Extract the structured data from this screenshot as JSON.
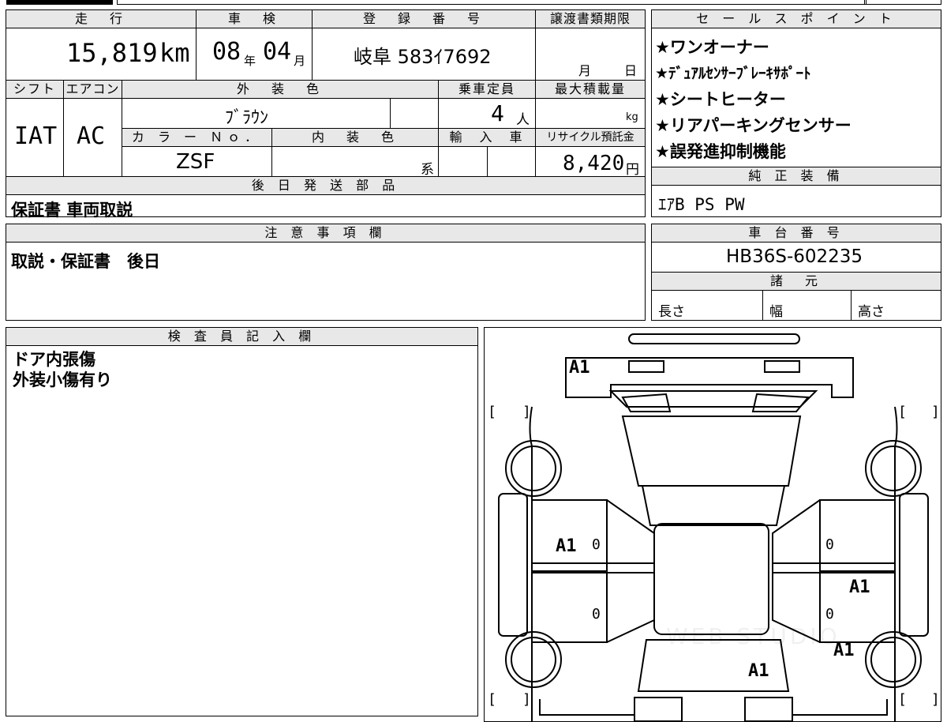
{
  "headers": {
    "mileage": "走　行",
    "inspection": "車　検",
    "registration": "登　録　番　号",
    "transfer_deadline": "譲渡書類期限",
    "sales_points": "セ ー ル ス ポ イ ン ト",
    "shift": "シフト",
    "aircon": "エアコン",
    "exterior_color": "外　装　色",
    "capacity": "乗車定員",
    "max_load": "最大積載量",
    "color_no": "カ ラ ー Ｎｏ．",
    "interior_color": "内　装　色",
    "import": "輸　入　車",
    "recycle_fee": "リサイクル預託金",
    "later_parts": "後 日 発 送 部 品",
    "genuine_equipment": "純 正 装 備",
    "notes": "注 意 事 項 欄",
    "chassis_no": "車 台 番 号",
    "specs": "諸　元",
    "inspector": "検 査 員 記 入 欄"
  },
  "vehicle": {
    "mileage_value": "15,819",
    "mileage_unit": "km",
    "inspection_year": "08",
    "inspection_year_unit": "年",
    "inspection_month": "04",
    "inspection_month_unit": "月",
    "registration_no": "岐阜 583ｲ7692",
    "deadline_month_unit": "月",
    "deadline_day_unit": "日",
    "shift": "IAT",
    "aircon": "AC",
    "exterior_color": "ﾌﾞﾗｳﾝ",
    "capacity_value": "4",
    "capacity_unit": "人",
    "max_load_unit": "kg",
    "color_no": "ZSF",
    "interior_unit": "系",
    "recycle_value": "8,420",
    "recycle_unit": "円"
  },
  "sales_points": [
    "★ワンオーナー",
    "★ﾃﾞｭｱﾙｾﾝｻｰﾌﾞﾚｰｷｻﾎﾟｰﾄ",
    "★シートヒーター",
    "★リアパーキングセンサー",
    "★誤発進抑制機能"
  ],
  "later_parts_value": "保証書 車両取説",
  "genuine_equipment_value": "ｴｱB PS PW",
  "notes_value": "取説・保証書　後日",
  "chassis_no_value": "HB36S-602235",
  "specs": {
    "length": "長さ",
    "width": "幅",
    "height": "高さ"
  },
  "inspector_notes": [
    "ドア内張傷",
    "外装小傷有り"
  ],
  "diagram_marks": {
    "front": "A1",
    "left_front_door": "A1",
    "right_rear_door": "A1",
    "right_rear_fender": "A1",
    "rear": "A1",
    "zero": "0",
    "bracket_open": "[",
    "bracket_close": "]"
  },
  "watermark": "WEB STUDIO"
}
